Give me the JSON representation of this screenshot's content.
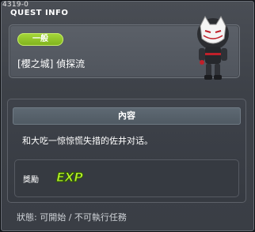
{
  "window": {
    "quest_id": "4319-0",
    "title": "QUEST INFO"
  },
  "quest": {
    "category_badge": "一般",
    "name": "[櫻之城] 偵探流"
  },
  "content": {
    "header": "內容",
    "description": "和大吃一惊惊慌失措的佐井对话。"
  },
  "reward": {
    "label": "獎勵",
    "exp_text": "EXP"
  },
  "status_text": "狀態: 可開始 / 不可執行任務",
  "colors": {
    "badge": "#8cc425",
    "exp": "#b6f02a",
    "panel": "#3a3e45"
  },
  "icons": {
    "npc": "ninja-fox-mask-npc-sprite",
    "exp": "exp-reward-icon"
  }
}
